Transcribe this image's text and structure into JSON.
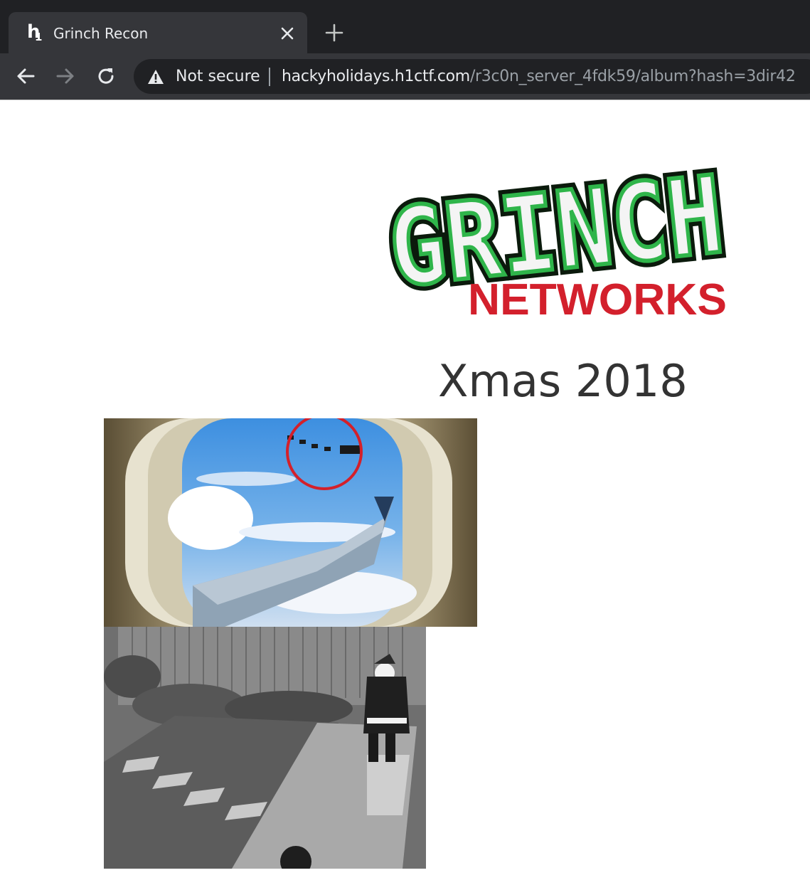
{
  "browser": {
    "tab_title": "Grinch Recon",
    "favicon": {
      "letter": "h",
      "digit": "1"
    },
    "security_label": "Not secure",
    "url_host": "hackyholidays.h1ctf.com",
    "url_path": "/r3c0n_server_4fdk59/album?hash=3dir42",
    "icons": [
      "back-arrow-icon",
      "forward-arrow-icon",
      "reload-icon",
      "warning-icon",
      "close-icon",
      "plus-icon"
    ]
  },
  "logo": {
    "line1": "GRINCH",
    "line2": "NETWORKS",
    "colors": {
      "green": "#2fb54a",
      "dark": "#0b1a0c",
      "red": "#d3202c"
    }
  },
  "album": {
    "title": "Xmas 2018"
  }
}
